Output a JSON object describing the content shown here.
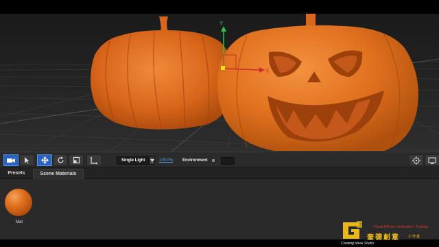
{
  "toolbar": {
    "tools": [
      {
        "icon": "camera-icon",
        "active": true
      },
      {
        "icon": "select-arrow-icon",
        "active": false
      },
      {
        "icon": "move-icon",
        "active": true
      },
      {
        "icon": "rotate-icon",
        "active": false
      },
      {
        "icon": "scale-icon",
        "active": false
      },
      {
        "icon": "local-axis-icon",
        "active": false
      }
    ],
    "lighting_label": "Single Light",
    "light_percent": "100.0%",
    "environment_label": "Environment",
    "right_icons": [
      "frame-target-icon",
      "screen-icon"
    ]
  },
  "viewport": {
    "gizmo_labels": {
      "y": "Y",
      "x": "X"
    },
    "pumpkin_color": "#e0711f"
  },
  "tabs": [
    {
      "label": "Presets",
      "active": false
    },
    {
      "label": "Scene Materials",
      "active": true
    }
  ],
  "materials": [
    {
      "name": "Mat",
      "color": "#e0711f"
    }
  ],
  "watermark": {
    "tagline": "• Visual Effects • Animation • Training",
    "chinese_name": "奎德創意",
    "chinese_sub": "工作室",
    "english_name": "Creating Ideas Studio"
  }
}
